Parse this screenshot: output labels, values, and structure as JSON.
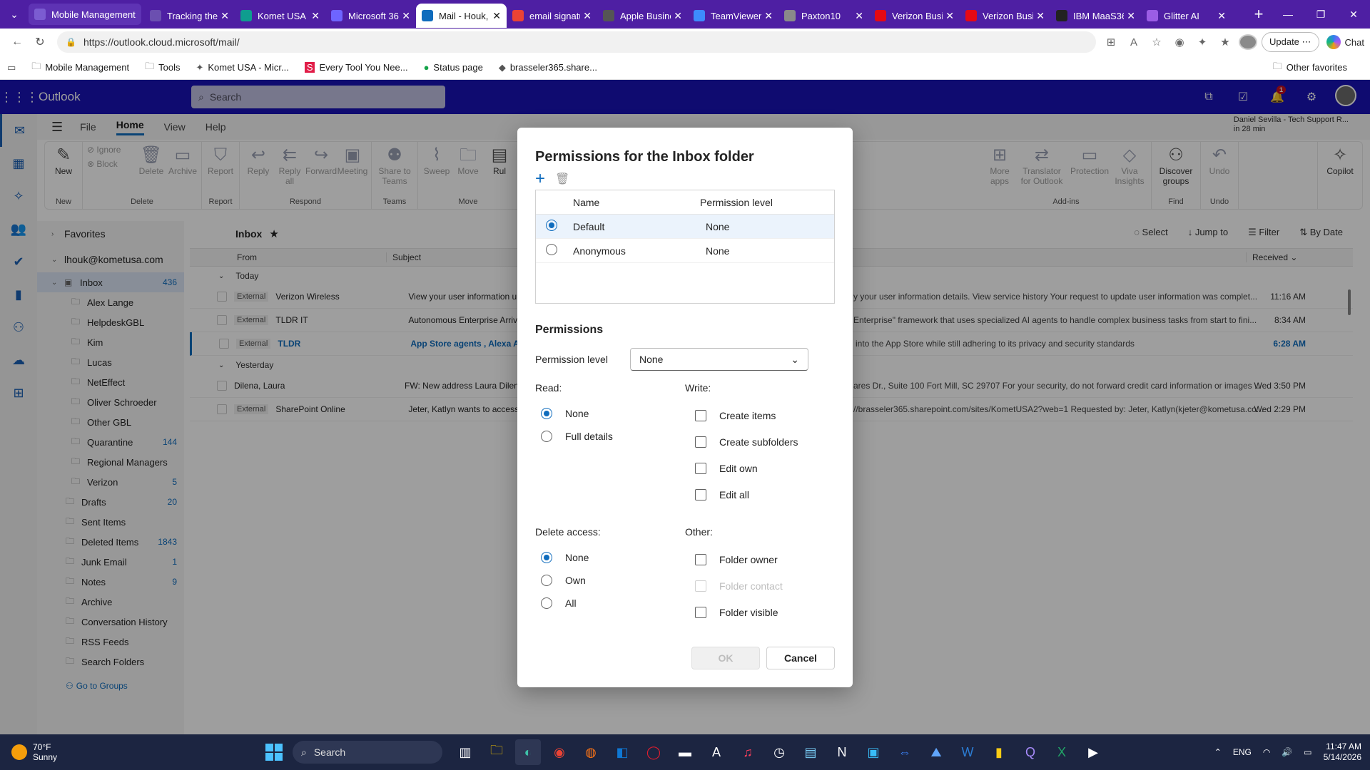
{
  "browser": {
    "tabs": [
      {
        "label": "Mobile Management",
        "color": "#7b5cd1"
      },
      {
        "label": "Tracking the",
        "color": "#6b4fb0"
      },
      {
        "label": "Komet USA I",
        "color": "#0f9d8f"
      },
      {
        "label": "Microsoft 36",
        "color": "#6e64ff"
      },
      {
        "label": "Mail - Houk,",
        "color": "#0f6cbd",
        "active": true
      },
      {
        "label": "email signatu",
        "color": "#ea4335"
      },
      {
        "label": "Apple Busine",
        "color": "#555555"
      },
      {
        "label": "TeamViewer",
        "color": "#3d8bfd"
      },
      {
        "label": "Paxton10",
        "color": "#8a8a8a"
      },
      {
        "label": "Verizon Busi",
        "color": "#e50914"
      },
      {
        "label": "Verizon Busi",
        "color": "#e50914"
      },
      {
        "label": "IBM MaaS36",
        "color": "#222222"
      },
      {
        "label": "Glitter AI",
        "color": "#9b5de5"
      }
    ],
    "url": "https://outlook.cloud.microsoft/mail/",
    "update_label": "Update",
    "chat_label": "Chat",
    "favorites": [
      {
        "label": "Mobile Management",
        "icon": "folder-icon"
      },
      {
        "label": "Tools",
        "icon": "folder-icon"
      },
      {
        "label": "Komet USA - Micr...",
        "icon": "komet-icon"
      },
      {
        "label": "Every Tool You Nee...",
        "icon": "s-icon"
      },
      {
        "label": "Status page",
        "icon": "green-dot-icon"
      },
      {
        "label": "brasseler365.share...",
        "icon": "sharepoint-icon"
      }
    ],
    "other_favorites": "Other favorites"
  },
  "outlook": {
    "brand": "Outlook",
    "search_placeholder": "Search",
    "notification_count": "1",
    "ribbon_tabs": [
      "File",
      "Home",
      "View",
      "Help"
    ],
    "active_tab": "Home",
    "reminder_title": "Daniel Sevilla - Tech Support R...",
    "reminder_time": "in 28 min",
    "ribbon": {
      "new": "New",
      "ignore": "Ignore",
      "block": "Block",
      "delete": "Delete",
      "archive": "Archive",
      "report": "Report",
      "reply": "Reply",
      "reply_all": "Reply all",
      "forward": "Forward",
      "meeting": "Meeting",
      "share_to_teams": "Share to Teams",
      "sweep": "Sweep",
      "move": "Move",
      "rules": "Rul",
      "more_apps": "More apps",
      "translator": "Translator for Outlook",
      "protection": "Protection",
      "viva": "Viva Insights",
      "discover": "Discover groups",
      "undo": "Undo",
      "copilot": "Copilot",
      "groups": {
        "new": "New",
        "delete": "Delete",
        "report": "Report",
        "respond": "Respond",
        "teams": "Teams",
        "move": "Move",
        "addins": "Add-ins",
        "find": "Find",
        "undo": "Undo"
      }
    },
    "folders": {
      "favorites": "Favorites",
      "account": "lhouk@kometusa.com",
      "inbox": {
        "label": "Inbox",
        "count": "436"
      },
      "subfolders": [
        {
          "label": "Alex Lange",
          "count": ""
        },
        {
          "label": "HelpdeskGBL",
          "count": ""
        },
        {
          "label": "Kim",
          "count": ""
        },
        {
          "label": "Lucas",
          "count": ""
        },
        {
          "label": "NetEffect",
          "count": ""
        },
        {
          "label": "Oliver Schroeder",
          "count": ""
        },
        {
          "label": "Other GBL",
          "count": ""
        },
        {
          "label": "Quarantine",
          "count": "144"
        },
        {
          "label": "Regional Managers",
          "count": ""
        },
        {
          "label": "Verizon",
          "count": "5"
        }
      ],
      "top_level": [
        {
          "label": "Drafts",
          "count": "20"
        },
        {
          "label": "Sent Items",
          "count": ""
        },
        {
          "label": "Deleted Items",
          "count": "1843"
        },
        {
          "label": "Junk Email",
          "count": "1"
        },
        {
          "label": "Notes",
          "count": "9"
        },
        {
          "label": "Archive",
          "count": ""
        },
        {
          "label": "Conversation History",
          "count": ""
        },
        {
          "label": "RSS Feeds",
          "count": ""
        },
        {
          "label": "Search Folders",
          "count": ""
        }
      ],
      "go_to_groups": "Go to Groups"
    },
    "list": {
      "title": "Inbox",
      "tools": [
        "Select",
        "Jump to",
        "Filter",
        "By Date"
      ],
      "col_from": "From",
      "col_subject": "Subject",
      "col_received": "Received",
      "group_today": "Today",
      "group_yesterday": "Yesterday",
      "today": [
        {
          "ext": "External",
          "from": "Verizon Wireless",
          "subject": "View your user information upda",
          "preview": "y your user information details. View service history Your request to update user information was complet...",
          "time": "11:16 AM",
          "unread": false
        },
        {
          "ext": "External",
          "from": "TLDR IT",
          "subject": "Autonomous Enterprise Arrives",
          "preview": "Enterprise\" framework that uses specialized AI agents to handle complex business tasks from start to fini...",
          "time": "8:34 AM",
          "unread": false
        },
        {
          "ext": "External",
          "from": "TLDR",
          "subject": "App Store agents , Alexa AI s",
          "preview": "into the App Store while still adhering to its privacy and security standards",
          "time": "6:28 AM",
          "unread": true
        }
      ],
      "yesterday": [
        {
          "ext": "",
          "from": "Dilena, Laura",
          "subject": "FW: New address  Laura Dilena S",
          "preview": "ares Dr., Suite 100 Fort Mill, SC 29707 For your security, do not forward credit card information or images ...",
          "time": "Wed 3:50 PM",
          "unread": false
        },
        {
          "ext": "External",
          "from": "SharePoint Online",
          "subject": "Jeter, Katlyn wants to access 'Kon",
          "preview": "//brasseler365.sharepoint.com/sites/KometUSA2?web=1 Requested by: Jeter, Katlyn(kjeter@kometusa.co...",
          "time": "Wed 2:29 PM",
          "unread": false
        }
      ]
    }
  },
  "dialog": {
    "title": "Permissions for the Inbox folder",
    "col_name": "Name",
    "col_level": "Permission level",
    "entries": [
      {
        "name": "Default",
        "level": "None",
        "selected": true
      },
      {
        "name": "Anonymous",
        "level": "None",
        "selected": false
      }
    ],
    "permissions_heading": "Permissions",
    "permission_level_label": "Permission level",
    "permission_level_value": "None",
    "read": {
      "label": "Read:",
      "options": [
        {
          "label": "None",
          "checked": true
        },
        {
          "label": "Full details",
          "checked": false
        }
      ]
    },
    "write": {
      "label": "Write:",
      "options": [
        {
          "label": "Create items",
          "checked": false
        },
        {
          "label": "Create subfolders",
          "checked": false
        },
        {
          "label": "Edit own",
          "checked": false
        },
        {
          "label": "Edit all",
          "checked": false
        }
      ]
    },
    "delete": {
      "label": "Delete access:",
      "options": [
        {
          "label": "None",
          "checked": true
        },
        {
          "label": "Own",
          "checked": false
        },
        {
          "label": "All",
          "checked": false
        }
      ]
    },
    "other": {
      "label": "Other:",
      "options": [
        {
          "label": "Folder owner",
          "checked": false,
          "disabled": false
        },
        {
          "label": "Folder contact",
          "checked": false,
          "disabled": true
        },
        {
          "label": "Folder visible",
          "checked": false,
          "disabled": false
        }
      ]
    },
    "ok_label": "OK",
    "cancel_label": "Cancel"
  },
  "taskbar": {
    "temp": "70°F",
    "condition": "Sunny",
    "search_placeholder": "Search",
    "lang": "ENG",
    "time": "11:47 AM",
    "date": "5/14/2026"
  }
}
